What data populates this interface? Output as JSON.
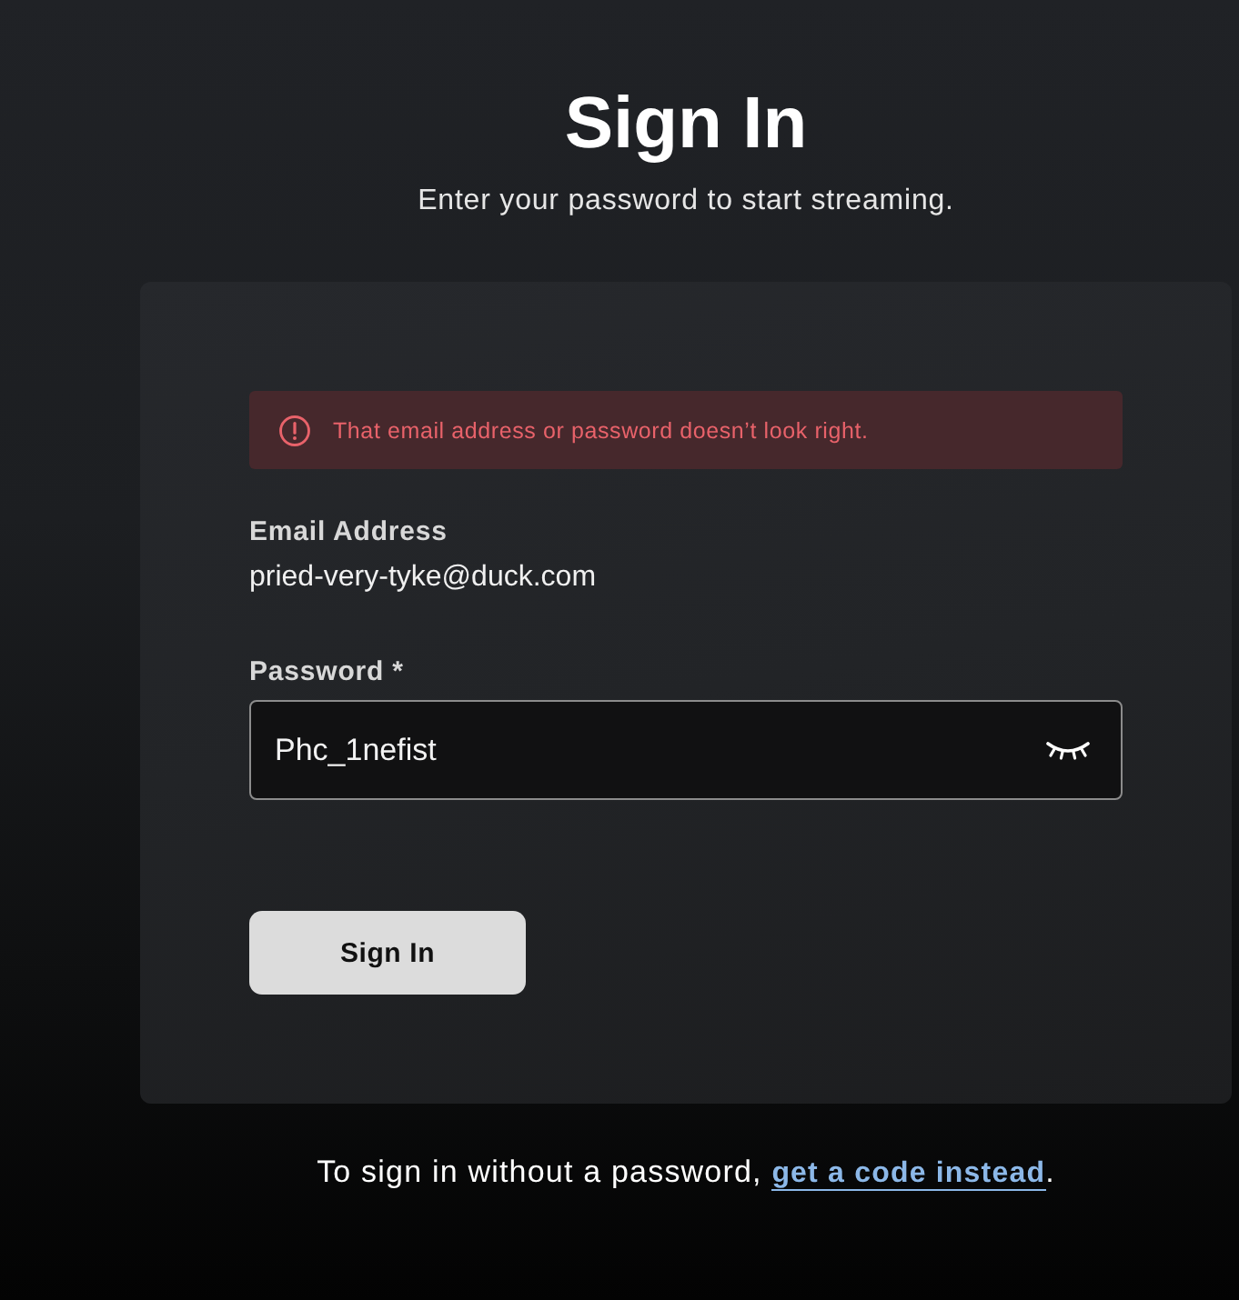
{
  "heading": {
    "title": "Sign In",
    "subtitle": "Enter your password to start streaming."
  },
  "alert": {
    "kind": "error",
    "message": "That email address or password doesn’t look right."
  },
  "email": {
    "label": "Email Address",
    "value": "pried-very-tyke@duck.com"
  },
  "password": {
    "label": "Password *",
    "value": "Phc_1nefist",
    "visible": true
  },
  "submit": {
    "label": "Sign In"
  },
  "footer": {
    "text": "To sign in without a password,",
    "link": "get a code instead",
    "suffix": "."
  }
}
